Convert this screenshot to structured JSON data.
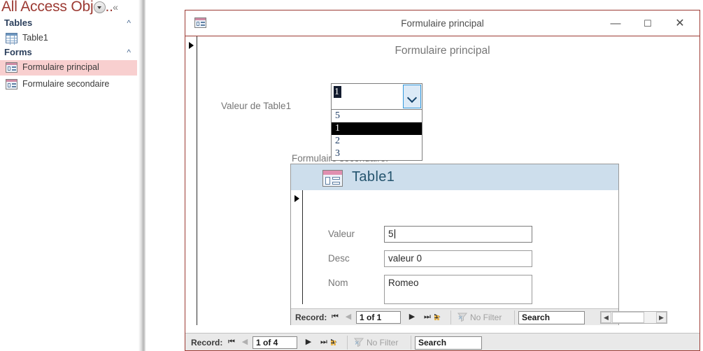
{
  "nav_pane": {
    "title": "All Access Obje...",
    "dropdown_icon": "chevron-down-circle-icon",
    "collapse_icon": "«",
    "groups": [
      {
        "label": "Tables",
        "chevron": "«",
        "items": [
          {
            "label": "Table1",
            "icon": "table-icon",
            "selected": false
          }
        ]
      },
      {
        "label": "Forms",
        "chevron": "«",
        "items": [
          {
            "label": "Formulaire principal",
            "icon": "form-icon",
            "selected": true
          },
          {
            "label": "Formulaire secondaire",
            "icon": "form-icon",
            "selected": false
          }
        ]
      }
    ]
  },
  "form_window": {
    "title": "Formulaire principal",
    "icon": "form-icon",
    "minimize_label": "—",
    "maximize_label": "☐",
    "close_label": "✕",
    "header_title": "Formulaire principal",
    "combo_label": "Valeur de Table1",
    "combo": {
      "value": "1",
      "arrow_icon": "chevron-down-icon",
      "options": [
        "5",
        "1",
        "2",
        "3"
      ],
      "highlighted_index": 1
    },
    "subform_label": "Formulaire secondaire:",
    "subform": {
      "header_title": "Table1",
      "header_icon": "form-icon",
      "fields": [
        {
          "label": "Valeur",
          "value": "5",
          "focused": true
        },
        {
          "label": "Desc",
          "value": "valeur 0",
          "focused": false
        },
        {
          "label": "Nom",
          "value": "Romeo",
          "focused": false
        }
      ],
      "navigator": {
        "record_label": "Record:",
        "first_icon": "⏮",
        "prev_icon": "◀",
        "position": "1 of 1",
        "next_icon": "▶",
        "last_icon": "⏭",
        "new_icon": "▶",
        "filter_label": "No Filter",
        "filter_icon": "filter-icon",
        "search_value": "Search"
      },
      "hscroll": {
        "left_icon": "◀",
        "right_icon": "▶"
      }
    },
    "navigator": {
      "record_label": "Record:",
      "first_icon": "⏮",
      "prev_icon": "◀",
      "position": "1 of 4",
      "next_icon": "▶",
      "last_icon": "⏭",
      "new_icon": "▶",
      "filter_label": "No Filter",
      "filter_icon": "filter-icon",
      "search_value": "Search"
    }
  },
  "colors": {
    "window_border": "#9c3a33",
    "nav_title": "#9c3a33",
    "nav_selected": "#f8cfcf",
    "subform_header": "#cddeec",
    "subform_title_text": "#24546e",
    "combo_focus": "#3399dd",
    "label_text": "#767676"
  }
}
